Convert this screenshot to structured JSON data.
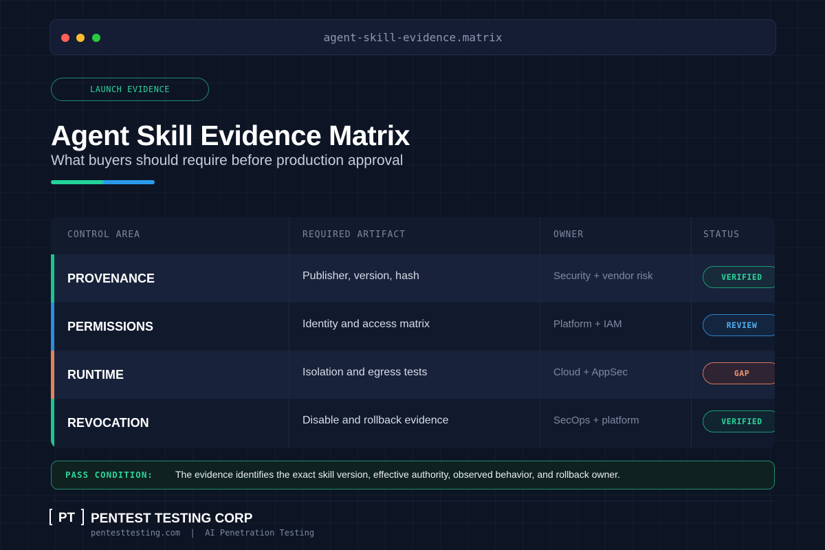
{
  "window": {
    "title": "agent-skill-evidence.matrix",
    "controls": [
      "close",
      "minimize",
      "maximize"
    ]
  },
  "header": {
    "tag": "LAUNCH EVIDENCE",
    "title": "Agent Skill Evidence Matrix",
    "subtitle": "What buyers should require before production approval"
  },
  "table": {
    "columns": [
      "CONTROL AREA",
      "REQUIRED ARTIFACT",
      "OWNER",
      "STATUS"
    ],
    "rows": [
      {
        "area": "PROVENANCE",
        "artifact": "Publisher, version, hash",
        "owner": "Security + vendor risk",
        "status": "VERIFIED",
        "status_kind": "verified",
        "accent": "#1fc48e"
      },
      {
        "area": "PERMISSIONS",
        "artifact": "Identity and access matrix",
        "owner": "Platform + IAM",
        "status": "REVIEW",
        "status_kind": "review",
        "accent": "#2a8fd8"
      },
      {
        "area": "RUNTIME",
        "artifact": "Isolation and egress tests",
        "owner": "Cloud + AppSec",
        "status": "GAP",
        "status_kind": "gap",
        "accent": "#e2835f"
      },
      {
        "area": "REVOCATION",
        "artifact": "Disable and rollback evidence",
        "owner": "SecOps + platform",
        "status": "VERIFIED",
        "status_kind": "verified",
        "accent": "#1fc48e"
      }
    ]
  },
  "pass_condition": {
    "label": "PASS CONDITION:",
    "text": "The evidence identifies the exact skill version, effective authority, observed behavior, and rollback owner."
  },
  "footer": {
    "logo_text": "PT",
    "brand": "PENTEST TESTING CORP",
    "url": "pentesttesting.com",
    "separator": "|",
    "tagline": "AI Penetration Testing"
  },
  "colors": {
    "accent_green": "#2fd39c",
    "accent_blue": "#2a9bea",
    "accent_orange": "#e2835f",
    "background": "#0d1424"
  }
}
